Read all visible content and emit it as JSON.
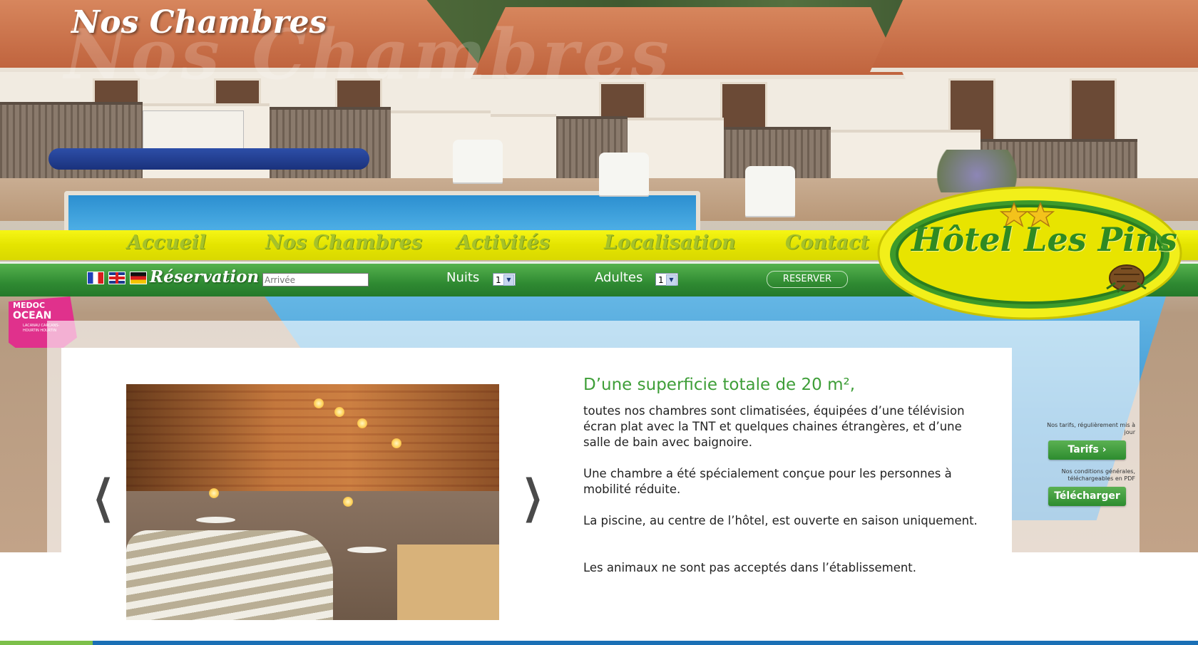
{
  "page": {
    "title": "Nos Chambres"
  },
  "menu": {
    "items": [
      {
        "label": "Accueil"
      },
      {
        "label": "Nos Chambres"
      },
      {
        "label": "Activités"
      },
      {
        "label": "Localisation"
      },
      {
        "label": "Contact"
      }
    ]
  },
  "reservation": {
    "languages": [
      "fr",
      "en",
      "de"
    ],
    "label": "Réservation",
    "arrival_placeholder": "Arrivée",
    "nights_label": "Nuits",
    "nights_value": "1",
    "adults_label": "Adultes",
    "adults_value": "1",
    "reserve_button": "RESERVER"
  },
  "logo": {
    "text": "Hôtel Les Pins",
    "stars": 2
  },
  "badge": {
    "line1": "MEDOC",
    "line2": "OCEAN",
    "line3": "LACANAU CARCANS-HOURTIN HOURTIN"
  },
  "content": {
    "heading": "D’une superficie totale de 20 m²,",
    "paragraphs": [
      "toutes nos chambres sont climatisées, équipées d’une télévision écran plat avec la TNT et quelques chaines étrangères, et d’une salle de bain avec baignoire.",
      "Une chambre a été spécialement conçue pour les personnes à mobilité réduite.",
      "La piscine, au centre de l’hôtel, est ouverte en saison uniquement.",
      "Les animaux ne sont pas acceptés dans l’établissement."
    ]
  },
  "carousel": {
    "prev": "❮",
    "next": "❯"
  },
  "sidebar": {
    "tarifs_note": "Nos tarifs, régulièrement mis à jour",
    "tarifs_button": "Tarifs  ›",
    "cgv_note": "Nos conditions générales, téléchargeables en PDF",
    "cgv_button": "Télécharger"
  },
  "colors": {
    "menu_yellow": "#e4e400",
    "menu_text": "#a6c22a",
    "res_green": "#2f8a32",
    "heading_green": "#3e9e38",
    "badge_pink": "#e0318c"
  }
}
